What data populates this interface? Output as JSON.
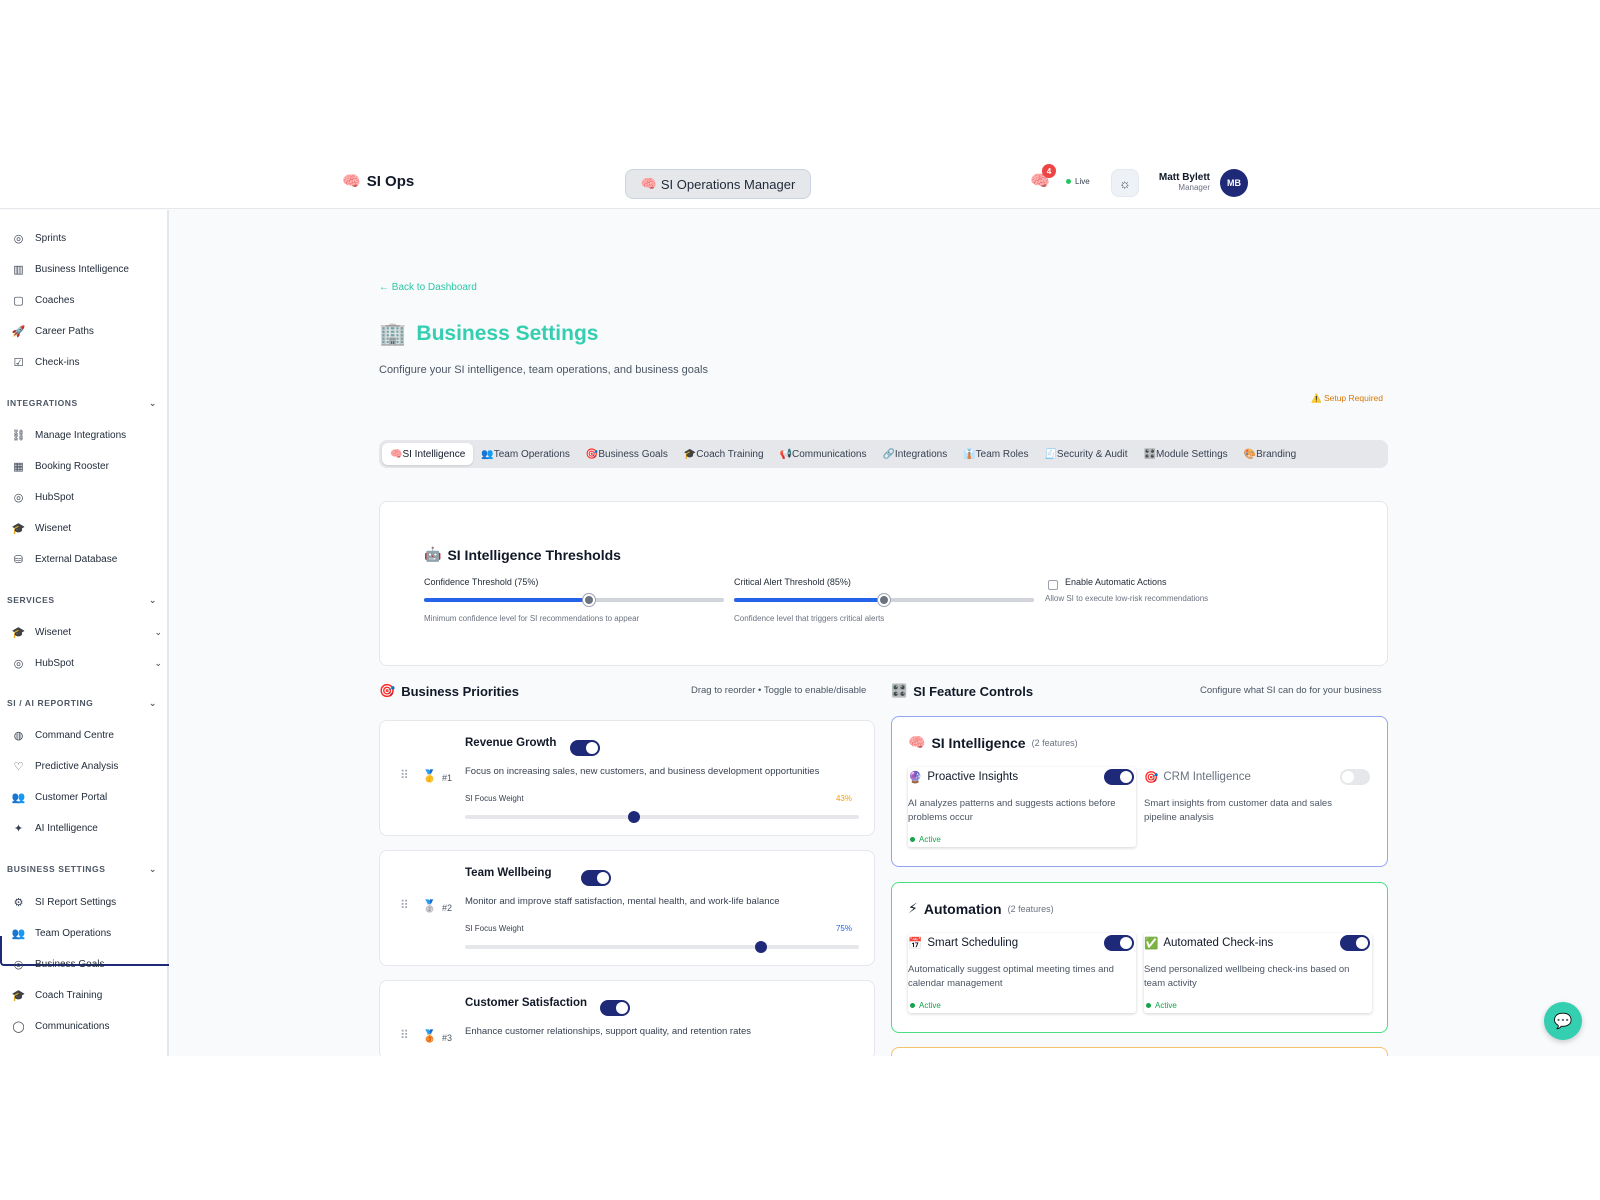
{
  "header": {
    "brand": "SI Ops",
    "brand_icon": "🧠",
    "manager_pill": "SI Operations Manager",
    "manager_icon": "🧠",
    "notifications_count": "4",
    "live": "Live",
    "user_name": "Matt Bylett",
    "user_role": "Manager",
    "avatar": "MB"
  },
  "sidebar": {
    "top_items": [
      {
        "label": "Sprints",
        "icon": "◎"
      },
      {
        "label": "Business Intelligence",
        "icon": "▥"
      },
      {
        "label": "Coaches",
        "icon": "▢"
      },
      {
        "label": "Career Paths",
        "icon": "🚀"
      },
      {
        "label": "Check-ins",
        "icon": "☑"
      }
    ],
    "integrations": {
      "title": "INTEGRATIONS",
      "items": [
        {
          "label": "Manage Integrations",
          "icon": "⛓"
        },
        {
          "label": "Booking Rooster",
          "icon": "▦"
        },
        {
          "label": "HubSpot",
          "icon": "◎"
        },
        {
          "label": "Wisenet",
          "icon": "🎓"
        },
        {
          "label": "External Database",
          "icon": "⛁"
        }
      ]
    },
    "services": {
      "title": "SERVICES",
      "items": [
        {
          "label": "Wisenet",
          "icon": "🎓"
        },
        {
          "label": "HubSpot",
          "icon": "◎"
        }
      ]
    },
    "reporting": {
      "title": "SI / AI REPORTING",
      "items": [
        {
          "label": "Command Centre",
          "icon": "◍"
        },
        {
          "label": "Predictive Analysis",
          "icon": "♡"
        },
        {
          "label": "Customer Portal",
          "icon": "👥"
        },
        {
          "label": "AI Intelligence",
          "icon": "✦"
        }
      ]
    },
    "business_settings": {
      "title": "BUSINESS SETTINGS",
      "items": [
        {
          "label": "SI Report Settings",
          "icon": "⚙"
        },
        {
          "label": "Team Operations",
          "icon": "👥"
        },
        {
          "label": "Business Goals",
          "icon": "◎"
        },
        {
          "label": "Coach Training",
          "icon": "🎓"
        },
        {
          "label": "Communications",
          "icon": "◯"
        }
      ]
    }
  },
  "main": {
    "back_link": "← Back to Dashboard",
    "title_icon": "🏢",
    "title": "Business Settings",
    "subtitle": "Configure your SI intelligence, team operations, and business goals",
    "setup_required": "⚠️ Setup Required",
    "tabs": [
      {
        "label": "🧠SI Intelligence"
      },
      {
        "label": "👥Team Operations"
      },
      {
        "label": "🎯Business Goals"
      },
      {
        "label": "🎓Coach Training"
      },
      {
        "label": "📢Communications"
      },
      {
        "label": "🔗Integrations"
      },
      {
        "label": "👔Team Roles"
      },
      {
        "label": "🧾Security & Audit"
      },
      {
        "label": "🎛️Module Settings"
      },
      {
        "label": "🎨Branding"
      }
    ],
    "thresholds": {
      "icon": "🤖",
      "title": "SI Intelligence Thresholds",
      "confidence_label": "Confidence Threshold (75%)",
      "confidence_value": 75,
      "confidence_hint": "Minimum confidence level for SI recommendations to appear",
      "critical_label": "Critical Alert Threshold (85%)",
      "critical_value": 85,
      "critical_hint": "Confidence level that triggers critical alerts",
      "auto_label": "Enable Automatic Actions",
      "auto_hint": "Allow SI to execute low-risk recommendations"
    },
    "priorities": {
      "icon": "🎯",
      "title": "Business Priorities",
      "hint": "Drag to reorder • Toggle to enable/disable",
      "items": [
        {
          "name": "Revenue Growth",
          "desc": "Focus on increasing sales, new customers, and business development opportunities",
          "medal": "🥇",
          "rank": "#1",
          "weight_label": "SI Focus Weight",
          "weight": "43%",
          "weight_color": "#f59e0b"
        },
        {
          "name": "Team Wellbeing",
          "desc": "Monitor and improve staff satisfaction, mental health, and work-life balance",
          "medal": "🥈",
          "rank": "#2",
          "weight_label": "SI Focus Weight",
          "weight": "75%",
          "weight_color": "#2563eb"
        },
        {
          "name": "Customer Satisfaction",
          "desc": "Enhance customer relationships, support quality, and retention rates",
          "medal": "🥉",
          "rank": "#3"
        }
      ]
    },
    "features": {
      "icon": "🎛️",
      "title": "SI Feature Controls",
      "hint": "Configure what SI can do for your business",
      "groups": [
        {
          "icon": "🧠",
          "title": "SI Intelligence",
          "count": "(2 features)",
          "border": "#93a4f5",
          "items": [
            {
              "icon": "🔮",
              "name": "Proactive Insights",
              "desc": "AI analyzes patterns and suggests actions before problems occur",
              "status": "Active",
              "on": true
            },
            {
              "icon": "🎯",
              "name": "CRM Intelligence",
              "desc": "Smart insights from customer data and sales pipeline analysis",
              "on": false
            }
          ]
        },
        {
          "icon": "⚡",
          "title": "Automation",
          "count": "(2 features)",
          "border": "#4ade80",
          "items": [
            {
              "icon": "📅",
              "name": "Smart Scheduling",
              "desc": "Automatically suggest optimal meeting times and calendar management",
              "status": "Active",
              "on": true
            },
            {
              "icon": "✅",
              "name": "Automated Check-ins",
              "desc": "Send personalized wellbeing check-ins based on team activity",
              "status": "Active",
              "on": true
            }
          ]
        }
      ]
    }
  }
}
